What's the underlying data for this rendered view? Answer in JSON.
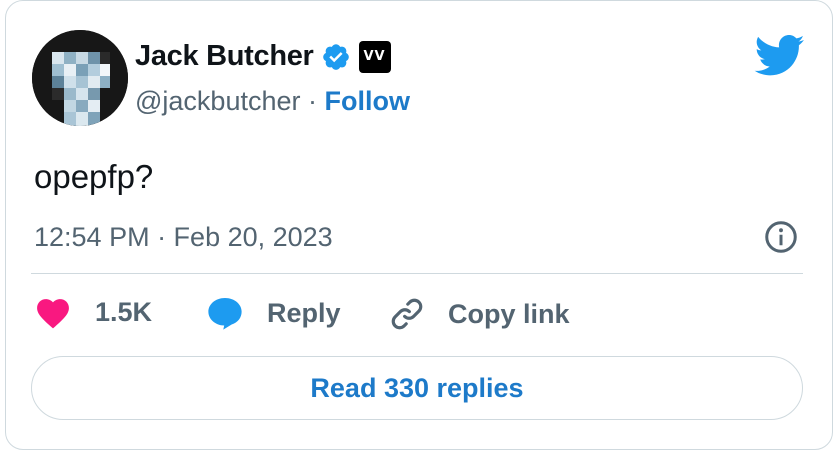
{
  "author": {
    "name": "Jack Butcher",
    "handle": "@jackbutcher",
    "separator": "·",
    "follow_label": "Follow",
    "badge_text": "VV"
  },
  "tweet": {
    "text": "opepfp?",
    "timestamp": "12:54 PM · Feb 20, 2023"
  },
  "actions": {
    "like_count": "1.5K",
    "reply_label": "Reply",
    "copy_label": "Copy link"
  },
  "read_replies_label": "Read 330 replies",
  "icons": [
    "twitter-bird-icon",
    "verified-badge-icon",
    "info-icon",
    "heart-icon",
    "reply-bubble-icon",
    "link-icon"
  ],
  "colors": {
    "accent": "#1d9bf0",
    "link_text": "#1d7ac9",
    "heart": "#f91880",
    "muted": "#536471",
    "text": "#0f1419",
    "border": "#cfd9de"
  }
}
